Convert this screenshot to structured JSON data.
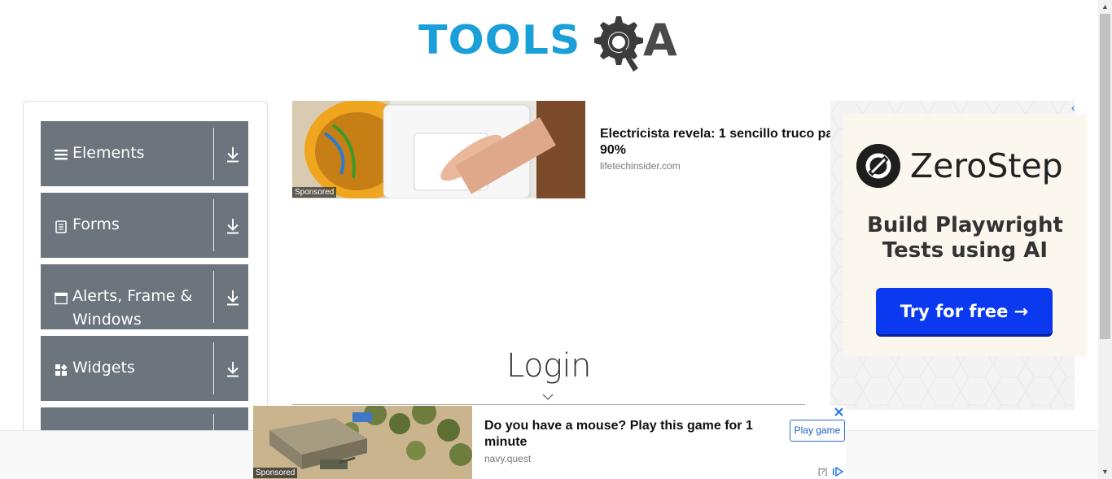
{
  "brand": {
    "logo_text_tools": "TOOLS",
    "logo_text_a": "A",
    "accent_blue": "#1a9fd9",
    "accent_grey": "#4a4a4a"
  },
  "sidebar": {
    "groups": [
      {
        "label": "Elements",
        "icon": "list-icon"
      },
      {
        "label": "Forms",
        "icon": "document-icon"
      },
      {
        "label": "Alerts, Frame &",
        "label2": "Windows",
        "icon": "window-icon"
      },
      {
        "label": "Widgets",
        "icon": "widgets-icon"
      },
      {
        "label": "",
        "icon": ""
      }
    ],
    "group_color": "#6c757d"
  },
  "ad_top": {
    "title": "Electricista revela: 1 sencillo truco pa",
    "title_line2": "90%",
    "domain": "lifetechinsider.com",
    "sponsored": "Sponsored"
  },
  "ad_right": {
    "brand": "ZeroStep",
    "tagline_1": "Build Playwright",
    "tagline_2": "Tests using AI",
    "cta": "Try for free →",
    "cta_color": "#0a39f0"
  },
  "main": {
    "title": "Login"
  },
  "ad_bottom": {
    "title": "Do you have a mouse? Play this game for 1 minute",
    "domain": "navy.quest",
    "cta": "Play game",
    "sponsored": "Sponsored",
    "help": "[?]"
  }
}
